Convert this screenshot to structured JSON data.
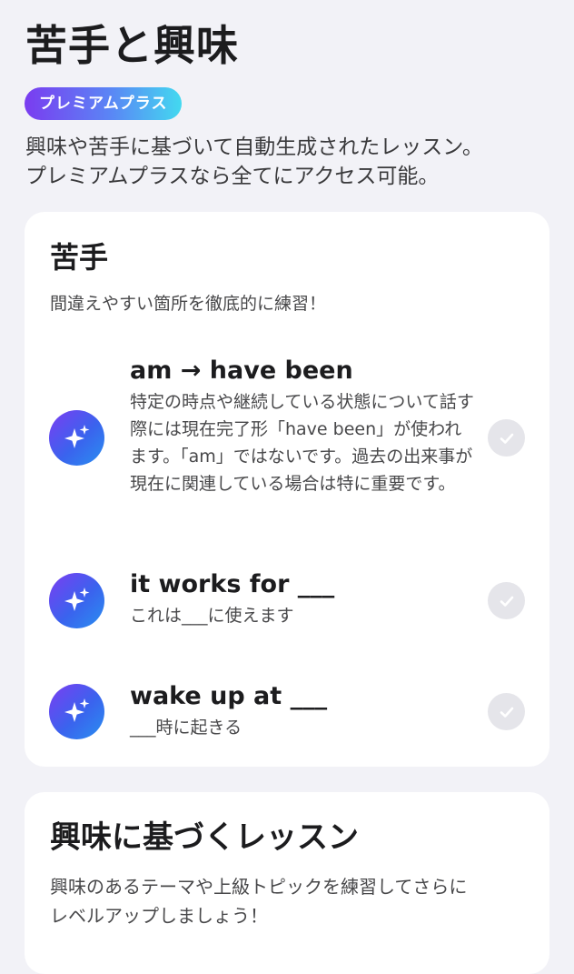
{
  "header": {
    "title": "苦手と興味",
    "badge": "プレミアムプラス",
    "intro": "興味や苦手に基づいて自動生成されたレッスン。\nプレミアムプラスなら全てにアクセス可能。"
  },
  "weak_section": {
    "title": "苦手",
    "description": "間違えやすい箇所を徹底的に練習！",
    "lessons": [
      {
        "title": "am → have been",
        "description": "特定の時点や継続している状態について話す際には現在完了形「have been」が使われます。「am」ではないです。過去の出来事が現在に関連している場合は特に重要です。",
        "icon": "sparkles-icon",
        "completed": false
      },
      {
        "title": "it works for ___",
        "description": "これは___に使えます",
        "icon": "sparkles-icon",
        "completed": false
      },
      {
        "title": "wake up at ___",
        "description": "___時に起きる",
        "icon": "sparkles-icon",
        "completed": false
      }
    ]
  },
  "interest_section": {
    "title": "興味に基づくレッスン",
    "description": "興味のあるテーマや上級トピックを練習してさらに\nレベルアップしましょう！"
  },
  "colors": {
    "background": "#f2f2f7",
    "card": "#ffffff",
    "badge_gradient_start": "#7a3cf0",
    "badge_gradient_end": "#43d9f0",
    "icon_gradient_start": "#7b3df2",
    "icon_gradient_end": "#2a8ff0",
    "check_bg": "#e5e5ea"
  }
}
